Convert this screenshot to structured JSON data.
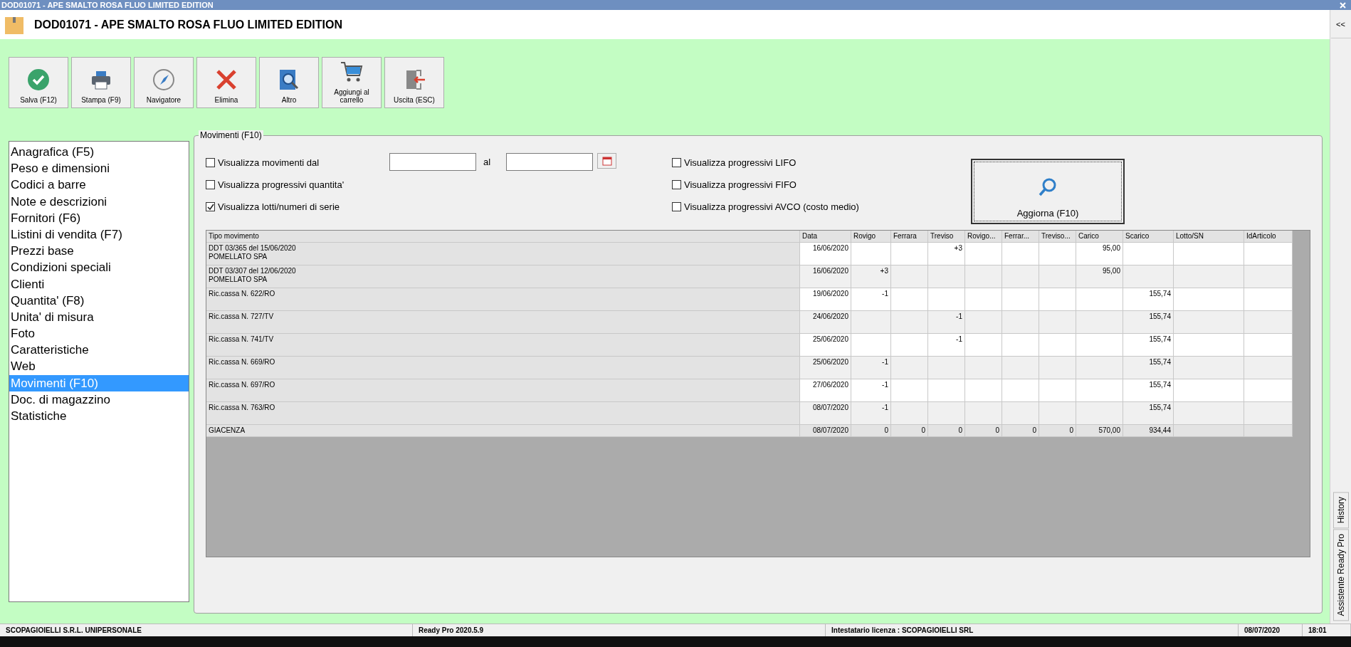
{
  "window": {
    "title": "DOD01071 - APE SMALTO ROSA FLUO LIMITED EDITION"
  },
  "header": {
    "title": "DOD01071 - APE SMALTO ROSA FLUO LIMITED EDITION"
  },
  "toolbar": [
    {
      "kind": "save",
      "label": "Salva (F12)"
    },
    {
      "kind": "print",
      "label": "Stampa (F9)"
    },
    {
      "kind": "navigator",
      "label": "Navigatore"
    },
    {
      "kind": "delete",
      "label": "Elimina"
    },
    {
      "kind": "other",
      "label": "Altro"
    },
    {
      "kind": "cart",
      "label": "Aggiungi al carrello"
    },
    {
      "kind": "exit",
      "label": "Uscita (ESC)"
    }
  ],
  "nav": [
    {
      "label": "Anagrafica (F5)",
      "selected": false
    },
    {
      "label": "Peso e dimensioni",
      "selected": false
    },
    {
      "label": "Codici a barre",
      "selected": false
    },
    {
      "label": "Note e descrizioni",
      "selected": false
    },
    {
      "label": "Fornitori (F6)",
      "selected": false
    },
    {
      "label": "Listini di vendita (F7)",
      "selected": false
    },
    {
      "label": "Prezzi base",
      "selected": false
    },
    {
      "label": "Condizioni speciali",
      "selected": false
    },
    {
      "label": "Clienti",
      "selected": false
    },
    {
      "label": "Quantita' (F8)",
      "selected": false
    },
    {
      "label": "Unita' di misura",
      "selected": false
    },
    {
      "label": "Foto",
      "selected": false
    },
    {
      "label": "Caratteristiche",
      "selected": false
    },
    {
      "label": "Web",
      "selected": false
    },
    {
      "label": "Movimenti (F10)",
      "selected": true
    },
    {
      "label": "Doc. di magazzino",
      "selected": false
    },
    {
      "label": "Statistiche",
      "selected": false
    }
  ],
  "panel": {
    "legend": "Movimenti (F10)",
    "options_left": [
      {
        "label": "Visualizza movimenti dal",
        "checked": false
      },
      {
        "label": "Visualizza progressivi quantita'",
        "checked": false
      },
      {
        "label": "Visualizza lotti/numeri di serie",
        "checked": true
      }
    ],
    "date_to_label": "al",
    "options_right": [
      {
        "label": "Visualizza progressivi LIFO",
        "checked": false
      },
      {
        "label": "Visualizza progressivi FIFO",
        "checked": false
      },
      {
        "label": "Visualizza progressivi AVCO (costo medio)",
        "checked": false
      }
    ],
    "refresh_button": "Aggiorna (F10)",
    "table": {
      "columns": [
        "Tipo movimento",
        "Data",
        "Rovigo",
        "Ferrara",
        "Treviso",
        "Rovigo...",
        "Ferrar...",
        "Treviso...",
        "Carico",
        "Scarico",
        "Lotto/SN",
        "IdArticolo"
      ],
      "rows": [
        {
          "kind": "movement",
          "cells": [
            "DDT 03/365 del 15/06/2020\nPOMELLATO SPA",
            "16/06/2020",
            "",
            "",
            "+3",
            "",
            "",
            "",
            "95,00",
            "",
            "",
            ""
          ]
        },
        {
          "kind": "movement",
          "cells": [
            "DDT 03/307 del 12/06/2020\nPOMELLATO SPA",
            "16/06/2020",
            "+3",
            "",
            "",
            "",
            "",
            "",
            "95,00",
            "",
            "",
            ""
          ]
        },
        {
          "kind": "movement",
          "cells": [
            "Ric.cassa N. 622/RO",
            "19/06/2020",
            "-1",
            "",
            "",
            "",
            "",
            "",
            "",
            "155,74",
            "",
            ""
          ]
        },
        {
          "kind": "movement",
          "cells": [
            "Ric.cassa N. 727/TV",
            "24/06/2020",
            "",
            "",
            "-1",
            "",
            "",
            "",
            "",
            "155,74",
            "",
            ""
          ]
        },
        {
          "kind": "movement",
          "cells": [
            "Ric.cassa N. 741/TV",
            "25/06/2020",
            "",
            "",
            "-1",
            "",
            "",
            "",
            "",
            "155,74",
            "",
            ""
          ]
        },
        {
          "kind": "movement",
          "cells": [
            "Ric.cassa N. 669/RO",
            "25/06/2020",
            "-1",
            "",
            "",
            "",
            "",
            "",
            "",
            "155,74",
            "",
            ""
          ]
        },
        {
          "kind": "movement",
          "cells": [
            "Ric.cassa N. 697/RO",
            "27/06/2020",
            "-1",
            "",
            "",
            "",
            "",
            "",
            "",
            "155,74",
            "",
            ""
          ]
        },
        {
          "kind": "movement",
          "cells": [
            "Ric.cassa N. 763/RO",
            "08/07/2020",
            "-1",
            "",
            "",
            "",
            "",
            "",
            "",
            "155,74",
            "",
            ""
          ]
        },
        {
          "kind": "total",
          "cells": [
            "GIACENZA",
            "08/07/2020",
            "0",
            "0",
            "0",
            "0",
            "0",
            "0",
            "570,00",
            "934,44",
            "",
            ""
          ]
        }
      ]
    }
  },
  "side_panel": {
    "collapse_button": "<<",
    "tabs": [
      "Assistente Ready Pro",
      "History"
    ]
  },
  "status_bar": [
    "SCOPAGIOIELLI S.R.L. UNIPERSONALE",
    "Ready Pro 2020.5.9",
    "Intestatario licenza : SCOPAGIOIELLI SRL",
    "08/07/2020",
    "18:01"
  ]
}
